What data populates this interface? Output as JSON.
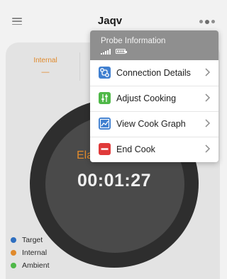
{
  "header": {
    "title": "Jaqv",
    "menu_icon": "hamburger-icon",
    "more_icon": "more-dots-icon"
  },
  "tabs": {
    "internal_label": "Internal",
    "internal_value": "—"
  },
  "dial": {
    "elapsed_label": "Ela",
    "timer": "00:01:27"
  },
  "legend": [
    {
      "label": "Target",
      "color": "#2f6fc0"
    },
    {
      "label": "Internal",
      "color": "#e08a2c"
    },
    {
      "label": "Ambient",
      "color": "#4fb848"
    }
  ],
  "menu": {
    "header_title": "Probe Information",
    "items": [
      {
        "label": "Connection Details",
        "icon": "connection-icon",
        "color": "#3f7fd0"
      },
      {
        "label": "Adjust Cooking",
        "icon": "adjust-sliders-icon",
        "color": "#4fb848"
      },
      {
        "label": "View Cook Graph",
        "icon": "graph-icon",
        "color": "#3f7fd0"
      },
      {
        "label": "End Cook",
        "icon": "end-cook-icon",
        "color": "#e03a3a"
      }
    ]
  },
  "colors": {
    "accent_orange": "#e08a2c",
    "dial_dark": "#2e2e2e",
    "dial_inner": "#4a4a4a",
    "menu_header": "#8f8f8f"
  }
}
